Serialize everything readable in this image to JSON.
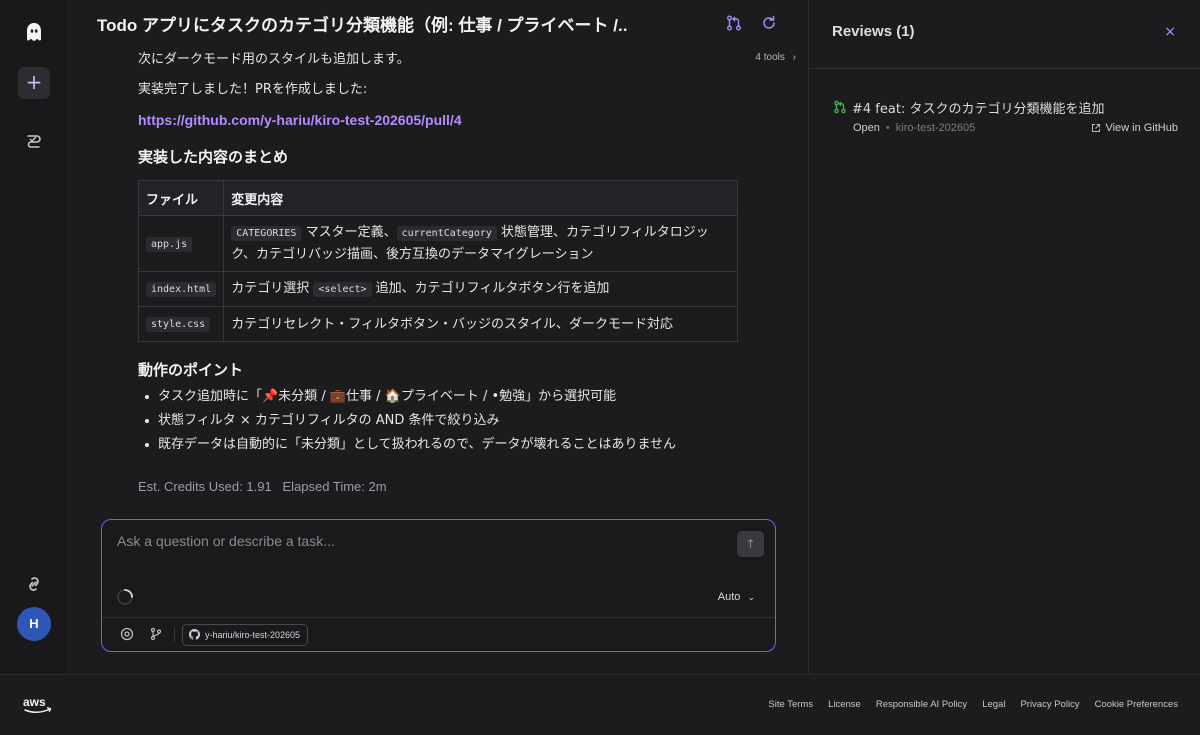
{
  "header": {
    "title": "Todo アプリにタスクのカテゴリ分類機能（例: 仕事 / プライベート /..."
  },
  "chat": {
    "intro_line": "次にダークモード用のスタイルも追加します。",
    "tools_label": "4 tools",
    "done_line": "実装完了しました！PRを作成しました:",
    "pr_link": "https://github.com/y-hariu/kiro-test-202605/pull/4",
    "summary_heading": "実装した内容のまとめ",
    "table": {
      "headers": [
        "ファイル",
        "変更内容"
      ],
      "rows": [
        {
          "file": "app.js",
          "code1": "CATEGORIES",
          "text1": " マスター定義、",
          "code2": "currentCategory",
          "text2": " 状態管理、カテゴリフィルタロジック、カテゴリバッジ描画、後方互換のデータマイグレーション"
        },
        {
          "file": "index.html",
          "text1": "カテゴリ選択 ",
          "code1": "<select>",
          "text2": " 追加、カテゴリフィルタボタン行を追加"
        },
        {
          "file": "style.css",
          "text1": "カテゴリセレクト・フィルタボタン・バッジのスタイル、ダークモード対応"
        }
      ]
    },
    "points_heading": "動作のポイント",
    "points": [
      "タスク追加時に「📌未分類 / 💼仕事 / 🏠プライベート / •勉強」から選択可能",
      "状態フィルタ × カテゴリフィルタの AND 条件で絞り込み",
      "既存データは自動的に「未分類」として扱われるので、データが壊れることはありません"
    ],
    "credits": "Est. Credits Used: 1.91   Elapsed Time: 2m"
  },
  "composer": {
    "placeholder": "Ask a question or describe a task...",
    "mode": "Auto",
    "repo": "y-hariu/kiro-test-202605"
  },
  "reviews": {
    "title": "Reviews (1)",
    "pr_title": "#4 feat: タスクのカテゴリ分類機能を追加",
    "status": "Open",
    "repo": "kiro-test-202605",
    "view_link": "View in GitHub"
  },
  "sidebar": {
    "avatar_initial": "H"
  },
  "footer": {
    "links": [
      "Site Terms",
      "License",
      "Responsible AI Policy",
      "Legal",
      "Privacy Policy",
      "Cookie Preferences"
    ]
  },
  "colors": {
    "accent": "#7c5cf0",
    "link": "#b58cff",
    "avatar": "#2f57b8",
    "pr_open": "#3fb950"
  },
  "icons": [
    "ghost-logo-icon",
    "plus-icon",
    "specs-icon",
    "integrations-icon",
    "pull-request-icon",
    "refresh-icon",
    "chevron-right-icon",
    "arrow-up-icon",
    "spinner-icon",
    "chevron-down-icon",
    "steering-icon",
    "branch-icon",
    "github-icon",
    "close-icon",
    "external-link-icon",
    "aws-logo-icon"
  ]
}
